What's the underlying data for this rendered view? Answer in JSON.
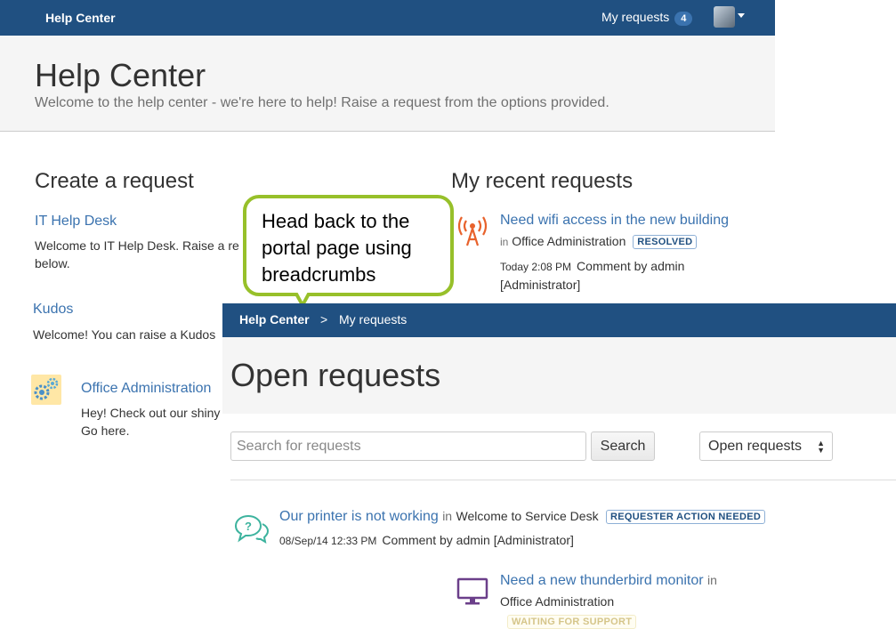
{
  "portal": {
    "brand": "Help Center",
    "my_requests_label": "My requests",
    "my_requests_count": "4",
    "hero_title": "Help Center",
    "hero_subtitle": "Welcome to the help center - we're here to help! Raise a request from the options provided.",
    "create_title": "Create a request",
    "recent_title": "My recent requests",
    "service_desks": [
      {
        "name": "IT Help Desk",
        "description": "Welcome to IT Help Desk. Raise a re below."
      },
      {
        "name": "Kudos",
        "description": "Welcome! You can raise a Kudos"
      },
      {
        "name": "Office Administration",
        "description": "Hey! Check out our shiny Go here.",
        "icon": "gears-icon"
      }
    ],
    "recent_request": {
      "title": "Need wifi access in the new building",
      "in_label": "in",
      "project": "Office Administration",
      "status": "RESOLVED",
      "time": "Today 2:08 PM",
      "activity": "Comment by admin [Administrator]",
      "icon": "wifi-tower-icon"
    }
  },
  "callout": {
    "text": "Head back to the portal page using breadcrumbs",
    "border_color": "#97c02a"
  },
  "requests_page": {
    "breadcrumb": {
      "home": "Help Center",
      "separator": ">",
      "current": "My requests"
    },
    "title": "Open requests",
    "search_placeholder": "Search for requests",
    "search_button": "Search",
    "filter_selected": "Open requests",
    "requests": [
      {
        "title": "Our printer is not working",
        "in_label": "in",
        "project": "Welcome to Service Desk",
        "status": "REQUESTER ACTION NEEDED",
        "time": "08/Sep/14 12:33 PM",
        "activity": "Comment by admin [Administrator]",
        "icon": "chat-bubbles-icon"
      },
      {
        "title": "Need a new thunderbird monitor",
        "in_label": "in",
        "project": "Office Administration",
        "status": "WAITING FOR SUPPORT",
        "icon": "monitor-icon"
      }
    ]
  },
  "colors": {
    "nav": "#205081",
    "link": "#3b73af",
    "resolved_lozenge": "#205081",
    "waiting_lozenge": "#d5c58a",
    "wifi_icon": "#e8622c",
    "chat_icon": "#3db39e",
    "monitor_icon": "#6b3f8a"
  }
}
